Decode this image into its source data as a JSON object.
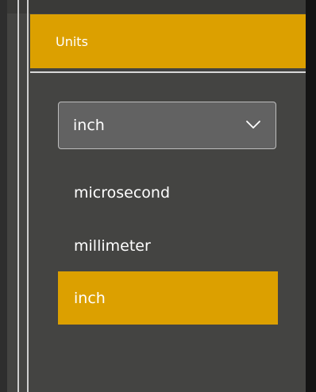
{
  "header": {
    "title": "Units"
  },
  "dropdown": {
    "selected": "inch",
    "icon": "chevron-down-icon"
  },
  "options": [
    {
      "label": "microsecond",
      "selected": false
    },
    {
      "label": "millimeter",
      "selected": false
    },
    {
      "label": "inch",
      "selected": true
    }
  ],
  "colors": {
    "accent": "#dca000",
    "panel": "#444442",
    "dropdown_bg": "#626262"
  }
}
